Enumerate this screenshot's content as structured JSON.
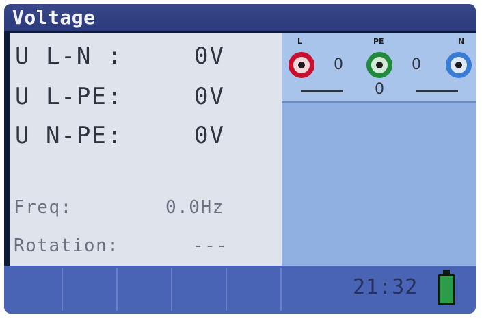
{
  "title": "Voltage",
  "measurements": [
    {
      "label": "U L-N :",
      "value": "0V"
    },
    {
      "label": "U L-PE:",
      "value": "0V"
    },
    {
      "label": "U N-PE:",
      "value": "0V"
    }
  ],
  "frequency": {
    "label": "Freq:",
    "value": "0.0Hz"
  },
  "rotation": {
    "label": "Rotation:",
    "value": "---"
  },
  "terminals": {
    "L": {
      "label": "L",
      "color": "#c8102e"
    },
    "PE": {
      "label": "PE",
      "color": "#1f8a3c"
    },
    "N": {
      "label": "N",
      "color": "#3a7bd5"
    },
    "L_PE_value": "0",
    "PE_N_value": "0",
    "L_N_value": "0"
  },
  "footer": {
    "time": "21:32",
    "battery_color": "#2d9c4a"
  }
}
